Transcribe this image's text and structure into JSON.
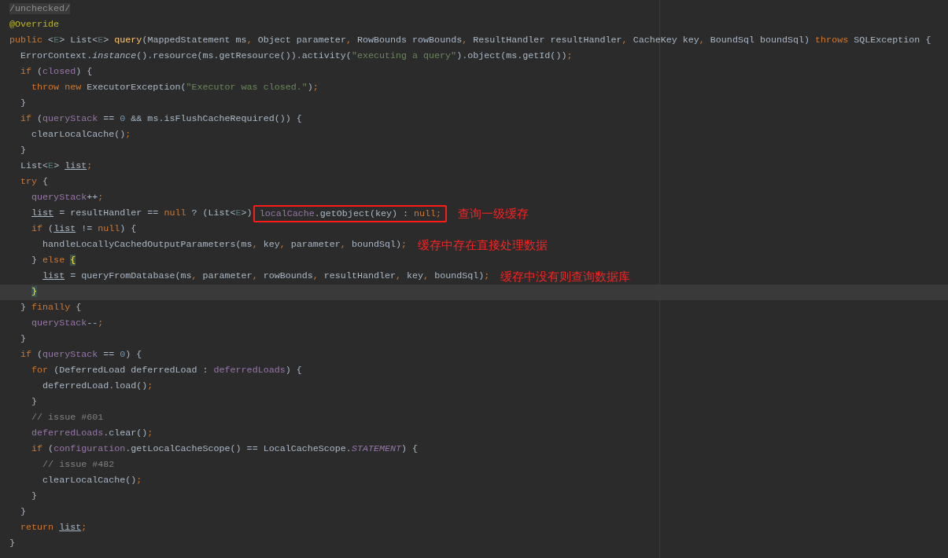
{
  "editor": {
    "lines": [
      {
        "current": false,
        "code": [
          {
            "text": "/unchecked/",
            "kind": "folded"
          }
        ]
      },
      {
        "current": false,
        "code": [
          {
            "text": "@Override",
            "kind": "annotation"
          }
        ]
      },
      {
        "current": false,
        "code": [
          {
            "text": "public ",
            "kind": "keyword"
          },
          {
            "text": "<",
            "kind": "plain"
          },
          {
            "text": "E",
            "kind": "typeparam"
          },
          {
            "text": "> List<",
            "kind": "plain"
          },
          {
            "text": "E",
            "kind": "typeparam"
          },
          {
            "text": "> ",
            "kind": "plain"
          },
          {
            "text": "query",
            "kind": "method"
          },
          {
            "text": "(MappedStatement ms",
            "kind": "plain"
          },
          {
            "text": ", ",
            "kind": "punct"
          },
          {
            "text": "Object parameter",
            "kind": "plain"
          },
          {
            "text": ", ",
            "kind": "punct"
          },
          {
            "text": "RowBounds rowBounds",
            "kind": "plain"
          },
          {
            "text": ", ",
            "kind": "punct"
          },
          {
            "text": "ResultHandler resultHandler",
            "kind": "plain"
          },
          {
            "text": ", ",
            "kind": "punct"
          },
          {
            "text": "CacheKey key",
            "kind": "plain"
          },
          {
            "text": ", ",
            "kind": "punct"
          },
          {
            "text": "BoundSql boundSql) ",
            "kind": "plain"
          },
          {
            "text": "throws ",
            "kind": "keyword"
          },
          {
            "text": "SQLException {",
            "kind": "plain"
          }
        ]
      },
      {
        "current": false,
        "code": [
          {
            "text": "  ErrorContext.",
            "kind": "plain"
          },
          {
            "text": "instance",
            "kind": "italic"
          },
          {
            "text": "().resource(ms.getResource()).activity(",
            "kind": "plain"
          },
          {
            "text": "\"executing a query\"",
            "kind": "string"
          },
          {
            "text": ").object(ms.getId())",
            "kind": "plain"
          },
          {
            "text": ";",
            "kind": "punct"
          }
        ]
      },
      {
        "current": false,
        "code": [
          {
            "text": "  if ",
            "kind": "keyword"
          },
          {
            "text": "(",
            "kind": "plain"
          },
          {
            "text": "closed",
            "kind": "field"
          },
          {
            "text": ") {",
            "kind": "plain"
          }
        ]
      },
      {
        "current": false,
        "code": [
          {
            "text": "    throw new ",
            "kind": "keyword"
          },
          {
            "text": "ExecutorException(",
            "kind": "plain"
          },
          {
            "text": "\"Executor was closed.\"",
            "kind": "string"
          },
          {
            "text": ")",
            "kind": "plain"
          },
          {
            "text": ";",
            "kind": "punct"
          }
        ]
      },
      {
        "current": false,
        "code": [
          {
            "text": "  }",
            "kind": "plain"
          }
        ]
      },
      {
        "current": false,
        "code": [
          {
            "text": "  if ",
            "kind": "keyword"
          },
          {
            "text": "(",
            "kind": "plain"
          },
          {
            "text": "queryStack",
            "kind": "field"
          },
          {
            "text": " == ",
            "kind": "plain"
          },
          {
            "text": "0",
            "kind": "number"
          },
          {
            "text": " && ms.isFlushCacheRequired()) {",
            "kind": "plain"
          }
        ]
      },
      {
        "current": false,
        "code": [
          {
            "text": "    clearLocalCache()",
            "kind": "plain"
          },
          {
            "text": ";",
            "kind": "punct"
          }
        ]
      },
      {
        "current": false,
        "code": [
          {
            "text": "  }",
            "kind": "plain"
          }
        ]
      },
      {
        "current": false,
        "code": [
          {
            "text": "  List<",
            "kind": "plain"
          },
          {
            "text": "E",
            "kind": "typeparam"
          },
          {
            "text": "> ",
            "kind": "plain"
          },
          {
            "text": "list",
            "kind": "reassigned"
          },
          {
            "text": ";",
            "kind": "punct"
          }
        ]
      },
      {
        "current": false,
        "code": [
          {
            "text": "  try ",
            "kind": "keyword"
          },
          {
            "text": "{",
            "kind": "plain"
          }
        ]
      },
      {
        "current": false,
        "code": [
          {
            "text": "    queryStack",
            "kind": "field"
          },
          {
            "text": "++",
            "kind": "plain"
          },
          {
            "text": ";",
            "kind": "punct"
          }
        ]
      },
      {
        "current": false,
        "code": [
          {
            "text": "    list",
            "kind": "reassigned"
          },
          {
            "text": " = resultHandler == ",
            "kind": "plain"
          },
          {
            "text": "null ",
            "kind": "keyword"
          },
          {
            "text": "? (List<",
            "kind": "plain"
          },
          {
            "text": "E",
            "kind": "typeparam"
          },
          {
            "text": ">)",
            "kind": "plain"
          }
        ],
        "boxed": [
          {
            "text": "localCache",
            "kind": "field"
          },
          {
            "text": ".getObject(key) : ",
            "kind": "plain"
          },
          {
            "text": "null",
            "kind": "keyword"
          },
          {
            "text": ";",
            "kind": "punct"
          }
        ],
        "note": "查询一级缓存"
      },
      {
        "current": false,
        "code": [
          {
            "text": "    if ",
            "kind": "keyword"
          },
          {
            "text": "(",
            "kind": "plain"
          },
          {
            "text": "list",
            "kind": "reassigned"
          },
          {
            "text": " != ",
            "kind": "plain"
          },
          {
            "text": "null",
            "kind": "keyword"
          },
          {
            "text": ") {",
            "kind": "plain"
          }
        ]
      },
      {
        "current": false,
        "code": [
          {
            "text": "      handleLocallyCachedOutputParameters(ms",
            "kind": "plain"
          },
          {
            "text": ", ",
            "kind": "punct"
          },
          {
            "text": "key",
            "kind": "plain"
          },
          {
            "text": ", ",
            "kind": "punct"
          },
          {
            "text": "parameter",
            "kind": "plain"
          },
          {
            "text": ", ",
            "kind": "punct"
          },
          {
            "text": "boundSql)",
            "kind": "plain"
          },
          {
            "text": ";",
            "kind": "punct"
          }
        ],
        "note": "缓存中存在直接处理数据"
      },
      {
        "current": false,
        "code": [
          {
            "text": "    } ",
            "kind": "plain"
          },
          {
            "text": "else ",
            "kind": "keyword"
          },
          {
            "text": "{",
            "kind": "brace"
          }
        ]
      },
      {
        "current": false,
        "code": [
          {
            "text": "      list",
            "kind": "reassigned"
          },
          {
            "text": " = queryFromDatabase(ms",
            "kind": "plain"
          },
          {
            "text": ", ",
            "kind": "punct"
          },
          {
            "text": "parameter",
            "kind": "plain"
          },
          {
            "text": ", ",
            "kind": "punct"
          },
          {
            "text": "rowBounds",
            "kind": "plain"
          },
          {
            "text": ", ",
            "kind": "punct"
          },
          {
            "text": "resultHandler",
            "kind": "plain"
          },
          {
            "text": ", ",
            "kind": "punct"
          },
          {
            "text": "key",
            "kind": "plain"
          },
          {
            "text": ", ",
            "kind": "punct"
          },
          {
            "text": "boundSql)",
            "kind": "plain"
          },
          {
            "text": ";",
            "kind": "punct"
          }
        ],
        "note": "缓存中没有则查询数据库"
      },
      {
        "current": true,
        "code": [
          {
            "text": "    }",
            "kind": "brace"
          }
        ]
      },
      {
        "current": false,
        "code": [
          {
            "text": "  } ",
            "kind": "plain"
          },
          {
            "text": "finally ",
            "kind": "keyword"
          },
          {
            "text": "{",
            "kind": "plain"
          }
        ]
      },
      {
        "current": false,
        "code": [
          {
            "text": "    queryStack",
            "kind": "field"
          },
          {
            "text": "--",
            "kind": "plain"
          },
          {
            "text": ";",
            "kind": "punct"
          }
        ]
      },
      {
        "current": false,
        "code": [
          {
            "text": "  }",
            "kind": "plain"
          }
        ]
      },
      {
        "current": false,
        "code": [
          {
            "text": "  if ",
            "kind": "keyword"
          },
          {
            "text": "(",
            "kind": "plain"
          },
          {
            "text": "queryStack",
            "kind": "field"
          },
          {
            "text": " == ",
            "kind": "plain"
          },
          {
            "text": "0",
            "kind": "number"
          },
          {
            "text": ") {",
            "kind": "plain"
          }
        ]
      },
      {
        "current": false,
        "code": [
          {
            "text": "    for ",
            "kind": "keyword"
          },
          {
            "text": "(DeferredLoad deferredLoad : ",
            "kind": "plain"
          },
          {
            "text": "deferredLoads",
            "kind": "field"
          },
          {
            "text": ") {",
            "kind": "plain"
          }
        ]
      },
      {
        "current": false,
        "code": [
          {
            "text": "      deferredLoad.load()",
            "kind": "plain"
          },
          {
            "text": ";",
            "kind": "punct"
          }
        ]
      },
      {
        "current": false,
        "code": [
          {
            "text": "    }",
            "kind": "plain"
          }
        ]
      },
      {
        "current": false,
        "code": [
          {
            "text": "    // issue #601",
            "kind": "comment"
          }
        ]
      },
      {
        "current": false,
        "code": [
          {
            "text": "    deferredLoads",
            "kind": "field"
          },
          {
            "text": ".clear()",
            "kind": "plain"
          },
          {
            "text": ";",
            "kind": "punct"
          }
        ]
      },
      {
        "current": false,
        "code": [
          {
            "text": "    if ",
            "kind": "keyword"
          },
          {
            "text": "(",
            "kind": "plain"
          },
          {
            "text": "configuration",
            "kind": "field"
          },
          {
            "text": ".getLocalCacheScope() == LocalCacheScope.",
            "kind": "plain"
          },
          {
            "text": "STATEMENT",
            "kind": "static"
          },
          {
            "text": ") {",
            "kind": "plain"
          }
        ]
      },
      {
        "current": false,
        "code": [
          {
            "text": "      // issue #482",
            "kind": "comment"
          }
        ]
      },
      {
        "current": false,
        "code": [
          {
            "text": "      clearLocalCache()",
            "kind": "plain"
          },
          {
            "text": ";",
            "kind": "punct"
          }
        ]
      },
      {
        "current": false,
        "code": [
          {
            "text": "    }",
            "kind": "plain"
          }
        ]
      },
      {
        "current": false,
        "code": [
          {
            "text": "  }",
            "kind": "plain"
          }
        ]
      },
      {
        "current": false,
        "code": [
          {
            "text": "  return ",
            "kind": "keyword"
          },
          {
            "text": "list",
            "kind": "reassigned"
          },
          {
            "text": ";",
            "kind": "punct"
          }
        ]
      },
      {
        "current": false,
        "code": [
          {
            "text": "}",
            "kind": "plain"
          }
        ]
      }
    ]
  }
}
